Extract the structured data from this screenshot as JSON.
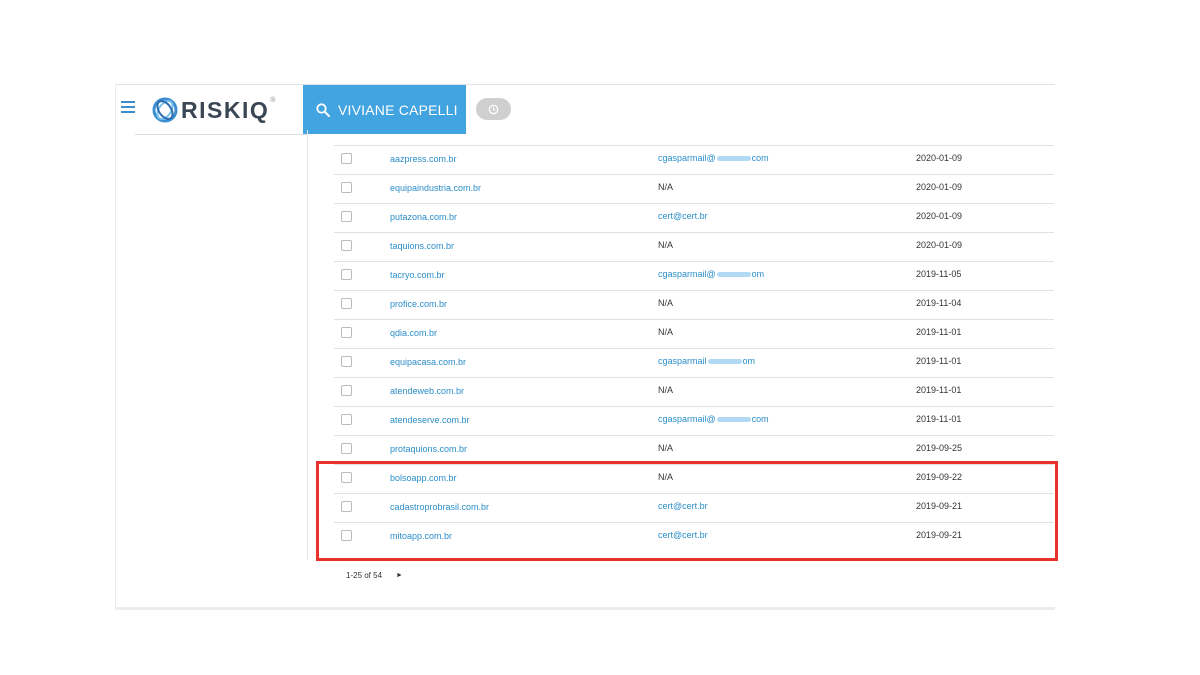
{
  "header": {
    "logo_text": "RISKIQ",
    "logo_mark": "®",
    "search_label": "VIVIANE CAPELLI",
    "icons": {
      "menu": "hamburger-icon",
      "search": "search-icon",
      "history": "clock-icon"
    },
    "accent_color": "#41a3e0"
  },
  "rows": [
    {
      "domain": "aazpress.com.br",
      "email": "cgasparmail@",
      "email_suffix": "com",
      "redacted": true,
      "date": "2020-01-09"
    },
    {
      "domain": "equipaindustria.com.br",
      "email": "N/A",
      "email_suffix": "",
      "redacted": false,
      "date": "2020-01-09"
    },
    {
      "domain": "putazona.com.br",
      "email": "cert@cert.br",
      "email_suffix": "",
      "redacted": false,
      "date": "2020-01-09"
    },
    {
      "domain": "taquions.com.br",
      "email": "N/A",
      "email_suffix": "",
      "redacted": false,
      "date": "2020-01-09"
    },
    {
      "domain": "tacryo.com.br",
      "email": "cgasparmail@",
      "email_suffix": "om",
      "redacted": true,
      "date": "2019-11-05"
    },
    {
      "domain": "profice.com.br",
      "email": "N/A",
      "email_suffix": "",
      "redacted": false,
      "date": "2019-11-04"
    },
    {
      "domain": "qdia.com.br",
      "email": "N/A",
      "email_suffix": "",
      "redacted": false,
      "date": "2019-11-01"
    },
    {
      "domain": "equipacasa.com.br",
      "email": "cgasparmail",
      "email_suffix": "om",
      "redacted": true,
      "date": "2019-11-01"
    },
    {
      "domain": "atendeweb.com.br",
      "email": "N/A",
      "email_suffix": "",
      "redacted": false,
      "date": "2019-11-01"
    },
    {
      "domain": "atendeserve.com.br",
      "email": "cgasparmail@",
      "email_suffix": "com",
      "redacted": true,
      "date": "2019-11-01"
    },
    {
      "domain": "protaquions.com.br",
      "email": "N/A",
      "email_suffix": "",
      "redacted": false,
      "date": "2019-09-25"
    },
    {
      "domain": "bolsoapp.com.br",
      "email": "N/A",
      "email_suffix": "",
      "redacted": false,
      "date": "2019-09-22"
    },
    {
      "domain": "cadastroprobrasil.com.br",
      "email": "cert@cert.br",
      "email_suffix": "",
      "redacted": false,
      "date": "2019-09-21"
    },
    {
      "domain": "mitoapp.com.br",
      "email": "cert@cert.br",
      "email_suffix": "",
      "redacted": false,
      "date": "2019-09-21"
    }
  ],
  "highlight_color": "#e8322b",
  "pagination": {
    "range": "1-25 of 54",
    "next": "►"
  }
}
